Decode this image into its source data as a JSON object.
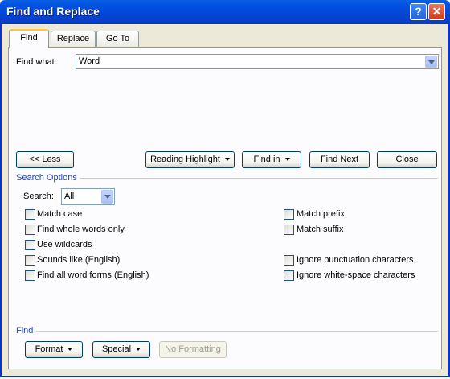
{
  "window": {
    "title": "Find and Replace"
  },
  "tabs": [
    {
      "label": "Find",
      "active": true
    },
    {
      "label": "Replace",
      "active": false
    },
    {
      "label": "Go To",
      "active": false
    }
  ],
  "find_what": {
    "label": "Find what:",
    "value": "Word"
  },
  "buttons": {
    "less": "<< Less",
    "reading_highlight": "Reading Highlight",
    "find_in": "Find in",
    "find_next": "Find Next",
    "close": "Close"
  },
  "search_options": {
    "header": "Search Options",
    "search_label": "Search:",
    "search_value": "All",
    "left_options": [
      {
        "label": "Match case",
        "checked": false
      },
      {
        "label": "Find whole words only",
        "checked": false
      },
      {
        "label": "Use wildcards",
        "checked": false
      },
      {
        "label": "Sounds like (English)",
        "checked": false
      },
      {
        "label": "Find all word forms (English)",
        "checked": false
      }
    ],
    "right_options": [
      {
        "label": "Match prefix",
        "checked": false
      },
      {
        "label": "Match suffix",
        "checked": false
      },
      {
        "label": "Ignore punctuation characters",
        "checked": false
      },
      {
        "label": "Ignore white-space characters",
        "checked": false
      }
    ]
  },
  "find_section": {
    "header": "Find",
    "format": "Format",
    "special": "Special",
    "no_formatting": "No Formatting"
  },
  "colors": {
    "title_bar": "#0054e3",
    "accent_label": "#1f47b0",
    "dialog_bg": "#ece9d8"
  }
}
